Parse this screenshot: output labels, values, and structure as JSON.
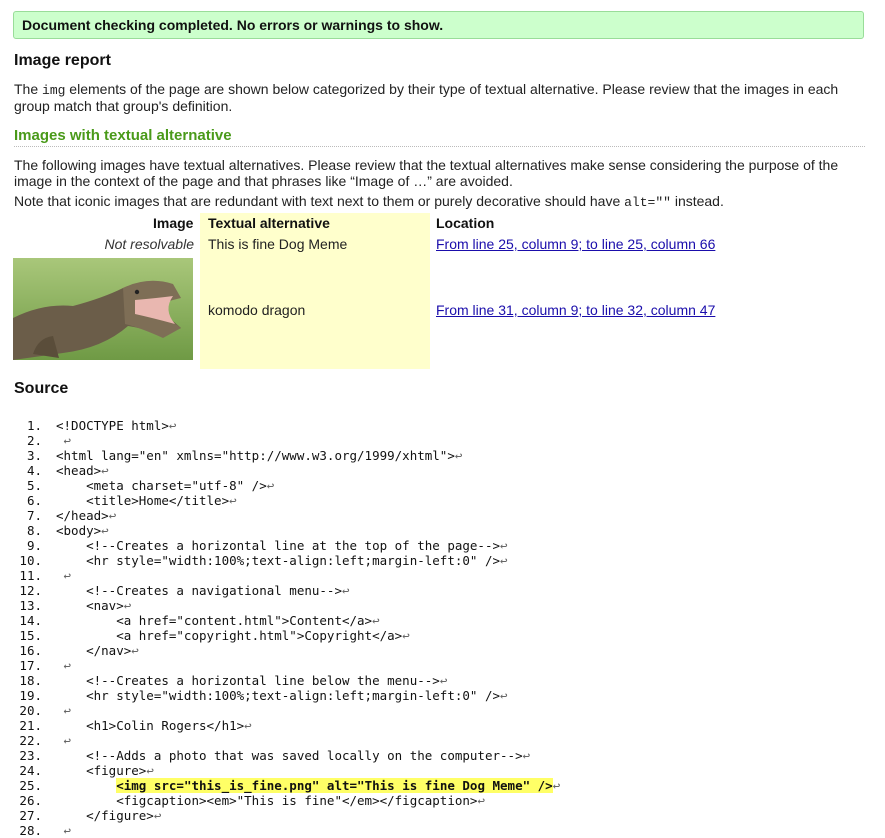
{
  "status_message": "Document checking completed. No errors or warnings to show.",
  "report": {
    "title": "Image report",
    "intro_pre": "The ",
    "intro_code": "img",
    "intro_post": " elements of the page are shown below categorized by their type of textual alternative. Please review that the images in each group match that group's definition."
  },
  "section": {
    "title": "Images with textual alternative",
    "description": "The following images have textual alternatives. Please review that the textual alternatives make sense considering the purpose of the image in the context of the page and that phrases like “Image of …” are avoided.",
    "note_pre": "Note that iconic images that are redundant with text next to them or purely decorative should have ",
    "note_code": "alt=\"\"",
    "note_post": " instead."
  },
  "table": {
    "headers": {
      "image": "Image",
      "alt": "Textual alternative",
      "location": "Location"
    },
    "rows": [
      {
        "image_text": "Not resolvable",
        "alt": "This is fine Dog Meme",
        "location": "From line 25, column 9; to line 25, column 66"
      },
      {
        "image_icon": "komodo-dragon-photo",
        "alt": "komodo dragon",
        "location": "From line 31, column 9; to line 32, column 47"
      }
    ]
  },
  "source": {
    "title": "Source",
    "return_symbol": "↩",
    "highlight_color": "#ffff66",
    "lines": [
      "<!DOCTYPE html>",
      "",
      "<html lang=\"en\" xmlns=\"http://www.w3.org/1999/xhtml\">",
      "<head>",
      "    <meta charset=\"utf-8\" />",
      "    <title>Home</title>",
      "</head>",
      "<body>",
      "    <!--Creates a horizontal line at the top of the page-->",
      "    <hr style=\"width:100%;text-align:left;margin-left:0\" />",
      "",
      "    <!--Creates a navigational menu-->",
      "    <nav>",
      "        <a href=\"content.html\">Content</a>",
      "        <a href=\"copyright.html\">Copyright</a>",
      "    </nav>",
      "",
      "    <!--Creates a horizontal line below the menu-->",
      "    <hr style=\"width:100%;text-align:left;margin-left:0\" />",
      "",
      "    <h1>Colin Rogers</h1>",
      "",
      "    <!--Adds a photo that was saved locally on the computer-->",
      "    <figure>",
      "        <img src=\"this_is_fine.png\" alt=\"This is fine Dog Meme\" />",
      "        <figcaption><em>\"This is fine\"</em></figcaption>",
      "    </figure>",
      ""
    ],
    "highlighted_line": 25,
    "highlight_indent": "        "
  },
  "colors": {
    "success_bg": "#ccffcc",
    "section_title": "#4a9a1a",
    "alt_column_bg": "#ffffcc",
    "link": "#1a0dab"
  }
}
